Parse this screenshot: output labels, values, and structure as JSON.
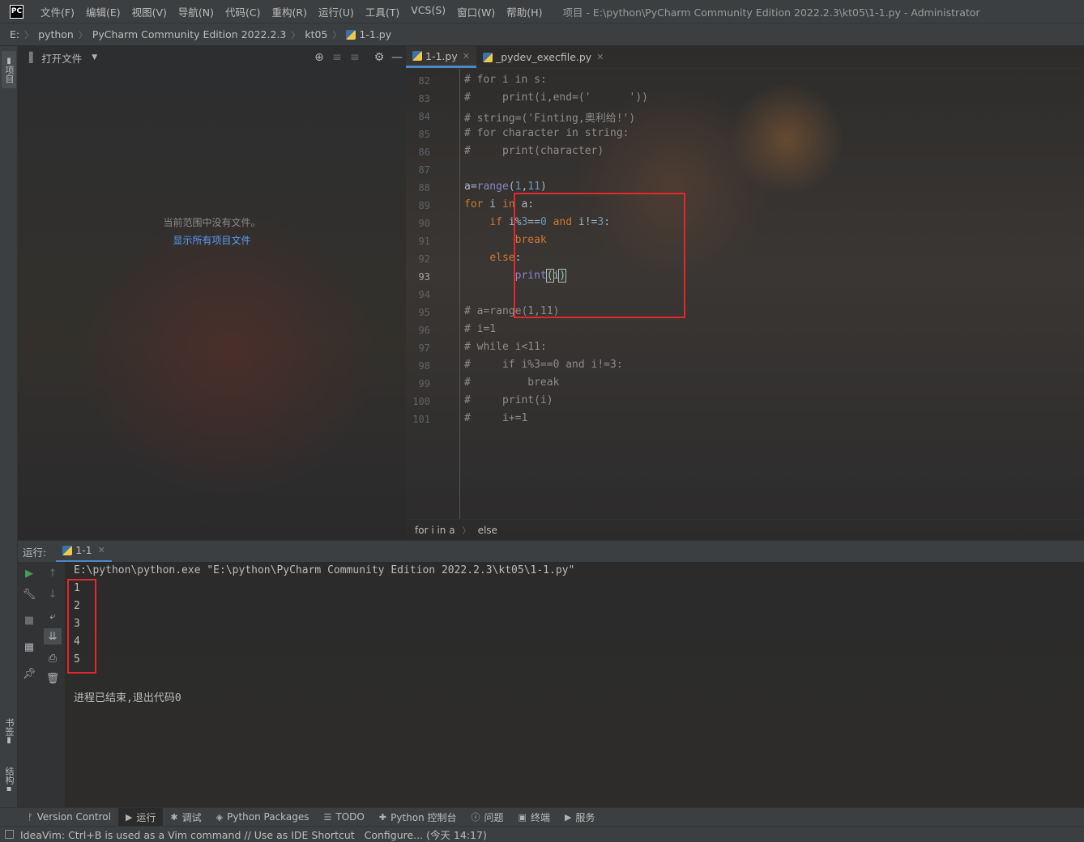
{
  "menubar": {
    "logo": "PC",
    "items": [
      "文件(F)",
      "编辑(E)",
      "视图(V)",
      "导航(N)",
      "代码(C)",
      "重构(R)",
      "运行(U)",
      "工具(T)",
      "VCS(S)",
      "窗口(W)",
      "帮助(H)"
    ],
    "title": "项目 - E:\\python\\PyCharm Community Edition 2022.2.3\\kt05\\1-1.py - Administrator"
  },
  "navbar": {
    "crumbs": [
      "E:",
      "python",
      "PyCharm Community Edition 2022.2.3",
      "kt05",
      "1-1.py"
    ]
  },
  "left_strip": {
    "project_tab": "项目",
    "bookmarks_tab": "书签",
    "structure_tab": "结构"
  },
  "project": {
    "title": "打开文件",
    "empty_text": "当前范围中没有文件。",
    "show_all_link": "显示所有项目文件"
  },
  "editor": {
    "tabs": [
      {
        "label": "1-1.py",
        "active": true
      },
      {
        "label": "_pydev_execfile.py",
        "active": false
      }
    ],
    "lines": [
      {
        "n": "82",
        "parts": [
          [
            "cm",
            "# for i in s:"
          ]
        ]
      },
      {
        "n": "83",
        "parts": [
          [
            "cm",
            "#     print(i,end=('      '))"
          ]
        ]
      },
      {
        "n": "84",
        "parts": [
          [
            "cm",
            "# string=('Finting,奥利给!')"
          ]
        ]
      },
      {
        "n": "85",
        "parts": [
          [
            "cm",
            "# for character in string:"
          ]
        ]
      },
      {
        "n": "86",
        "parts": [
          [
            "cm",
            "#     print(character)"
          ]
        ]
      },
      {
        "n": "87",
        "parts": [
          [
            "",
            ""
          ]
        ]
      },
      {
        "n": "88",
        "parts": [
          [
            "",
            "a="
          ],
          [
            "fn",
            "range"
          ],
          [
            "",
            "("
          ],
          [
            "num",
            "1"
          ],
          [
            "",
            ","
          ],
          [
            "num",
            "11"
          ],
          [
            "",
            ")"
          ]
        ]
      },
      {
        "n": "89",
        "parts": [
          [
            "kw",
            "for"
          ],
          [
            "",
            " i "
          ],
          [
            "kw",
            "in"
          ],
          [
            "",
            " a:"
          ]
        ]
      },
      {
        "n": "90",
        "parts": [
          [
            "",
            "    "
          ],
          [
            "kw",
            "if"
          ],
          [
            "",
            " i%"
          ],
          [
            "num",
            "3"
          ],
          [
            "",
            "=="
          ],
          [
            "num",
            "0"
          ],
          [
            "",
            " "
          ],
          [
            "kw",
            "and"
          ],
          [
            "",
            " i!="
          ],
          [
            "num",
            "3"
          ],
          [
            "",
            ":"
          ]
        ]
      },
      {
        "n": "91",
        "parts": [
          [
            "",
            "        "
          ],
          [
            "kw",
            "break"
          ]
        ]
      },
      {
        "n": "92",
        "parts": [
          [
            "",
            "    "
          ],
          [
            "kw",
            "else"
          ],
          [
            "",
            ":"
          ]
        ]
      },
      {
        "n": "93",
        "parts": [
          [
            "",
            "        "
          ],
          [
            "fn",
            "print"
          ],
          [
            "cur",
            "("
          ],
          [
            "",
            "i"
          ],
          [
            "cur",
            ")"
          ]
        ]
      },
      {
        "n": "94",
        "parts": [
          [
            "",
            ""
          ]
        ]
      },
      {
        "n": "95",
        "parts": [
          [
            "cm",
            "# a=range(1,11)"
          ]
        ]
      },
      {
        "n": "96",
        "parts": [
          [
            "cm",
            "# i=1"
          ]
        ]
      },
      {
        "n": "97",
        "parts": [
          [
            "cm",
            "# while i<11:"
          ]
        ]
      },
      {
        "n": "98",
        "parts": [
          [
            "cm",
            "#     if i%3==0 and i!=3:"
          ]
        ]
      },
      {
        "n": "99",
        "parts": [
          [
            "cm",
            "#         break"
          ]
        ]
      },
      {
        "n": "100",
        "parts": [
          [
            "cm",
            "#     print(i)"
          ]
        ]
      },
      {
        "n": "101",
        "parts": [
          [
            "cm",
            "#     i+=1"
          ]
        ]
      }
    ],
    "breadcrumb": [
      "for i in a",
      "else"
    ]
  },
  "run": {
    "label": "运行:",
    "tab": "1-1",
    "command": "E:\\python\\python.exe \"E:\\python\\PyCharm Community Edition 2022.2.3\\kt05\\1-1.py\"",
    "output": [
      "1",
      "2",
      "3",
      "4",
      "5"
    ],
    "exit_message": "进程已结束,退出代码0"
  },
  "toolwindows": [
    "Version Control",
    "运行",
    "调试",
    "Python Packages",
    "TODO",
    "Python 控制台",
    "问题",
    "终端",
    "服务"
  ],
  "status": {
    "message": "IdeaVim: Ctrl+B is used as a Vim command // Use as IDE Shortcut   Configure... (今天 14:17)"
  },
  "colors": {
    "accent": "#4a88c7",
    "annotation_red": "#e0282d",
    "keyword": "#cc7832",
    "number": "#6897bb",
    "builtin": "#8888c6",
    "comment": "#8c8c8c"
  }
}
